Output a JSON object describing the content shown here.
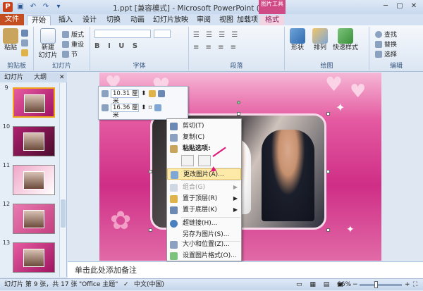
{
  "window": {
    "title": "1.ppt [兼容模式] - Microsoft PowerPoint (试用版)",
    "picture_tools": "图片工具"
  },
  "tabs": [
    "文件",
    "开始",
    "插入",
    "设计",
    "切换",
    "动画",
    "幻灯片放映",
    "审阅",
    "视图",
    "加载项",
    "格式"
  ],
  "ribbon": {
    "groups": [
      "剪贴板",
      "幻灯片",
      "字体",
      "段落",
      "绘图",
      "编辑"
    ],
    "paste": "粘贴",
    "new_slide": "新建\n幻灯片",
    "layout": "版式",
    "reset": "重设",
    "section": "节",
    "shape": "形状",
    "arrange": "排列",
    "quick_styles": "快速样式",
    "find": "查找",
    "replace": "替换",
    "select": "选择"
  },
  "panel": {
    "tab_slides": "幻灯片",
    "tab_outline": "大纲",
    "slides": [
      {
        "num": "9"
      },
      {
        "num": "10"
      },
      {
        "num": "11"
      },
      {
        "num": "12"
      },
      {
        "num": "13"
      }
    ]
  },
  "mini_toolbar": {
    "height": "10.31 厘米",
    "width": "16.36 厘米"
  },
  "context_menu": {
    "items": [
      {
        "label": "剪切(T)",
        "icon": "cut-icon",
        "disabled": false
      },
      {
        "label": "复制(C)",
        "icon": "copy-icon",
        "disabled": false
      },
      {
        "label": "粘贴选项:",
        "icon": "paste-icon",
        "disabled": false
      },
      {
        "label": "更改图片(A)...",
        "icon": "change-picture-icon",
        "disabled": false,
        "highlighted": true
      },
      {
        "label": "组合(G)",
        "icon": "group-icon",
        "disabled": true
      },
      {
        "label": "置于顶层(R)",
        "icon": "bring-front-icon",
        "disabled": false
      },
      {
        "label": "置于底层(K)",
        "icon": "send-back-icon",
        "disabled": false
      },
      {
        "label": "超链接(H)...",
        "icon": "hyperlink-icon",
        "disabled": false
      },
      {
        "label": "另存为图片(S)...",
        "icon": "save-picture-icon",
        "disabled": false
      },
      {
        "label": "大小和位置(Z)...",
        "icon": "size-icon",
        "disabled": false
      },
      {
        "label": "设置图片格式(O)...",
        "icon": "format-picture-icon",
        "disabled": false
      }
    ]
  },
  "notes": {
    "placeholder": "单击此处添加备注"
  },
  "status": {
    "slide_info": "幻灯片 第 9 张，共 17 张",
    "theme": "\"Office 主题\"",
    "language": "中文(中国)",
    "zoom": "66%"
  },
  "colors": {
    "file_tab": "#c44e1f",
    "picture_tools": "#d04a86",
    "slide_pink": "#cf2e86"
  }
}
